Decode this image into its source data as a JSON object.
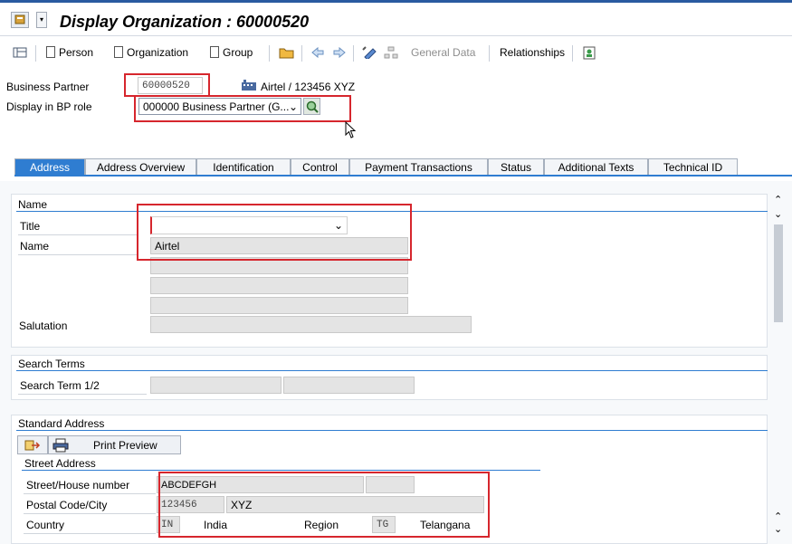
{
  "window": {
    "title": "Display Organization : 60000520"
  },
  "toolbar": {
    "person": "Person",
    "organization": "Organization",
    "group": "Group",
    "general_data": "General Data",
    "relationships": "Relationships"
  },
  "header": {
    "bp_label": "Business Partner",
    "bp_value": "60000520",
    "bp_desc": "Airtel / 123456 XYZ",
    "role_label": "Display in BP role",
    "role_value": "000000 Business Partner (G..."
  },
  "tabs": [
    {
      "label": "Address",
      "active": true
    },
    {
      "label": "Address Overview"
    },
    {
      "label": "Identification"
    },
    {
      "label": "Control"
    },
    {
      "label": "Payment Transactions"
    },
    {
      "label": "Status"
    },
    {
      "label": "Additional Texts"
    },
    {
      "label": "Technical ID"
    }
  ],
  "name_group": {
    "title": "Name",
    "title_label": "Title",
    "title_value": "",
    "name_label": "Name",
    "name_value": "Airtel",
    "salutation_label": "Salutation"
  },
  "search_group": {
    "title": "Search Terms",
    "term_label": "Search Term 1/2"
  },
  "address_group": {
    "title": "Standard Address",
    "print_preview": "Print Preview",
    "street_title": "Street Address",
    "street_label": "Street/House number",
    "street_value": "ABCDEFGH",
    "postal_label": "Postal Code/City",
    "postal_value": "123456",
    "city_value": "XYZ",
    "country_label": "Country",
    "country_code": "IN",
    "country_name": "India",
    "region_label": "Region",
    "region_code": "TG",
    "region_name": "Telangana"
  },
  "colors": {
    "accent": "#2f7dd1",
    "highlight": "#d6262d"
  }
}
